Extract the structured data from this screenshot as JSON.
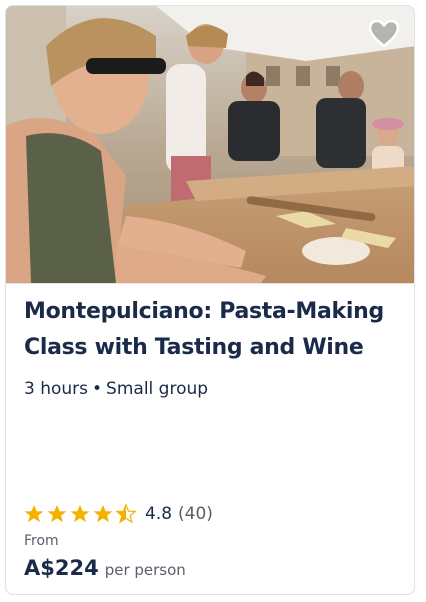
{
  "card": {
    "title": "Montepulciano: Pasta-Making Class with Tasting and Wine",
    "duration": "3 hours",
    "separator": "•",
    "group": "Small group",
    "rating": {
      "value": "4.8",
      "count": "(40)",
      "stars": 4.8
    },
    "price": {
      "from_label": "From",
      "amount": "A$224",
      "unit": "per person"
    },
    "wishlist_icon": "heart-icon"
  },
  "colors": {
    "text_primary": "#1a2b49",
    "text_secondary": "#585f6b",
    "star": "#f5b000",
    "border": "#dcdfe4"
  }
}
